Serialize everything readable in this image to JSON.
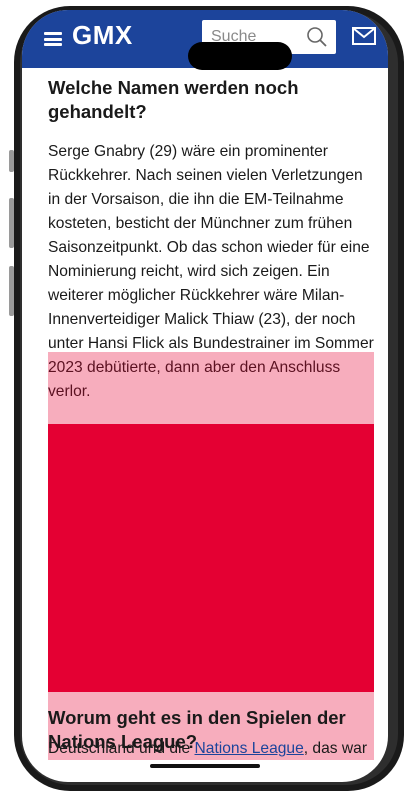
{
  "header": {
    "logo": "GMX",
    "search_placeholder": "Suche"
  },
  "article": {
    "heading": "Welche Namen werden noch gehandelt?",
    "paragraph": "Serge Gnabry (29) wäre ein prominenter Rückkehrer. Nach seinen vielen Verletzungen in der Vorsaison, die ihn die EM-Teilnahme kosteten, besticht der Münchner zum frühen Saisonzeitpunkt. Ob das schon wieder für eine Nominierung reicht, wird sich zeigen. Ein weiterer möglicher Rückkehrer wäre Milan-Innenverteidiger Malick Thiaw (23), der noch unter Hansi Flick als Bundestrainer im Sommer 2023 debütierte, dann aber den Anschluss verlor.",
    "heading2": "Worum geht es in den Spielen der Nations League?",
    "next_line_prefix": "Deutschland und die ",
    "next_line_link": "Nations League",
    "next_line_suffix": ", das war"
  },
  "colors": {
    "header_bg": "#1c449b",
    "ad_red": "#e40033",
    "link": "#1c449b"
  },
  "icons": [
    "menu-icon",
    "search-icon",
    "mail-icon"
  ]
}
